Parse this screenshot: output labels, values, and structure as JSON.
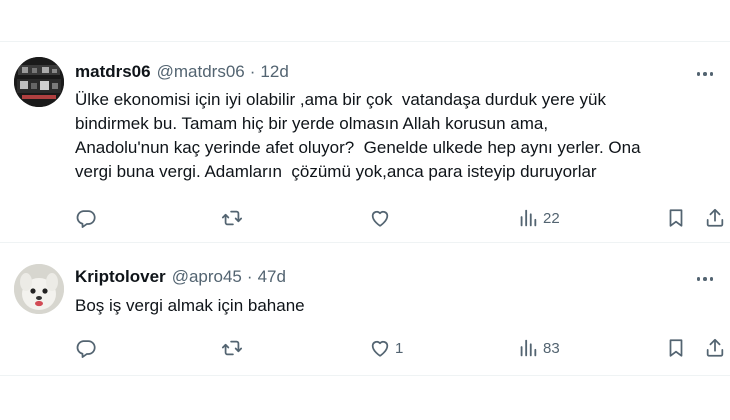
{
  "tweets": [
    {
      "display_name": "matdrs06",
      "handle": "@matdrs06",
      "separator": "·",
      "time": "12d",
      "text_lines": [
        "Ülke ekonomisi için iyi olabilir ,ama bir çok  vatandaşa durduk yere yük",
        "bindirmek bu. Tamam hiç bir yerde olmasın Allah korusun ama,",
        "Anadolu'nun kaç yerinde afet oluyor?  Genelde ulkede hep aynı yerler. Ona",
        "vergi buna vergi. Adamların  çözümü yok,anca para isteyip duruyorlar"
      ],
      "replies": "",
      "reposts": "",
      "likes": "",
      "views": "22"
    },
    {
      "display_name": "Kriptolover",
      "handle": "@apro45",
      "separator": "·",
      "time": "47d",
      "text_lines": [
        "Boş iş vergi almak için bahane"
      ],
      "replies": "",
      "reposts": "",
      "likes": "1",
      "views": "83"
    }
  ],
  "icons": {
    "reply": "reply-bubble-icon",
    "repost": "repost-arrows-icon",
    "like": "heart-icon",
    "views": "bar-chart-icon",
    "bookmark": "bookmark-icon",
    "share": "share-upload-icon",
    "more": "more-dots-icon"
  },
  "colors": {
    "text": "#0f1419",
    "secondary": "#536471",
    "divider": "#eff3f4",
    "background": "#ffffff"
  }
}
